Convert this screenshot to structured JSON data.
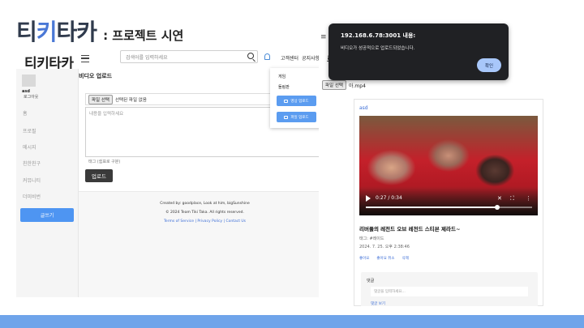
{
  "slide": {
    "logo": [
      "티",
      "키",
      "타",
      "카"
    ],
    "subtitle": ": 프로젝트 시연"
  },
  "app": {
    "logo": "티키타카",
    "search_placeholder": "검색어를 입력하세요",
    "nav_links": [
      "고객센터",
      "공지사항"
    ],
    "sidebar": {
      "user_id": "asd",
      "logout": "로그아웃",
      "items": [
        "홈",
        "프로필",
        "메시지",
        "친한친구",
        "커뮤니티",
        "더미비번"
      ],
      "write_button": "글쓰기"
    },
    "upload": {
      "title": "비디오 업로드",
      "file_button": "파일 선택",
      "file_status": "선택된 파일 없음",
      "content_placeholder": "내용을 입력하세요",
      "tag_placeholder": "태그 (쉼표로 구분)",
      "submit": "업로드"
    },
    "footer": {
      "created_by": "Created by: goodplace, Look at him, bigSunshine",
      "copyright": "© 2024 Team Tiki Taka. All rights reserved.",
      "links": "Terms of Service | Privacy Policy | Contact Us"
    },
    "dropdown": {
      "items": [
        "게임",
        "돌림판"
      ],
      "video_upload": "영상 업로드",
      "image_upload": "파일 업로드"
    }
  },
  "video_page": {
    "header_partial": "로 업",
    "file_button": "파일 선택",
    "file_name": "아.mp4",
    "card": {
      "user": "asd",
      "current_time": "0:27 / 0:34",
      "progress": 0.79,
      "title": "리버풀의 레전드 오브 레전드 스티븐 제라드~",
      "tags": "태그: #레이드",
      "date": "2024. 7. 25. 오후 2:38:46",
      "actions": [
        "좋아요",
        "좋아요 취소",
        "삭제"
      ],
      "comment_label": "댓글",
      "comment_placeholder": "댓글을 입력하세요...",
      "show_comments": "댓글 보기"
    }
  },
  "alert": {
    "title": "192.168.6.78:3001 내용:",
    "message": "비디오가 성공적으로 업로드되었습니다.",
    "ok": "확인"
  },
  "colors": {
    "accent": "#4e95f2",
    "logo_dark": "#2f3a4c",
    "logo_blue": "#4a78d6",
    "alert_bg": "#202124",
    "alert_button": "#a8c7fa",
    "bottom_band": "#6fa4ea"
  }
}
